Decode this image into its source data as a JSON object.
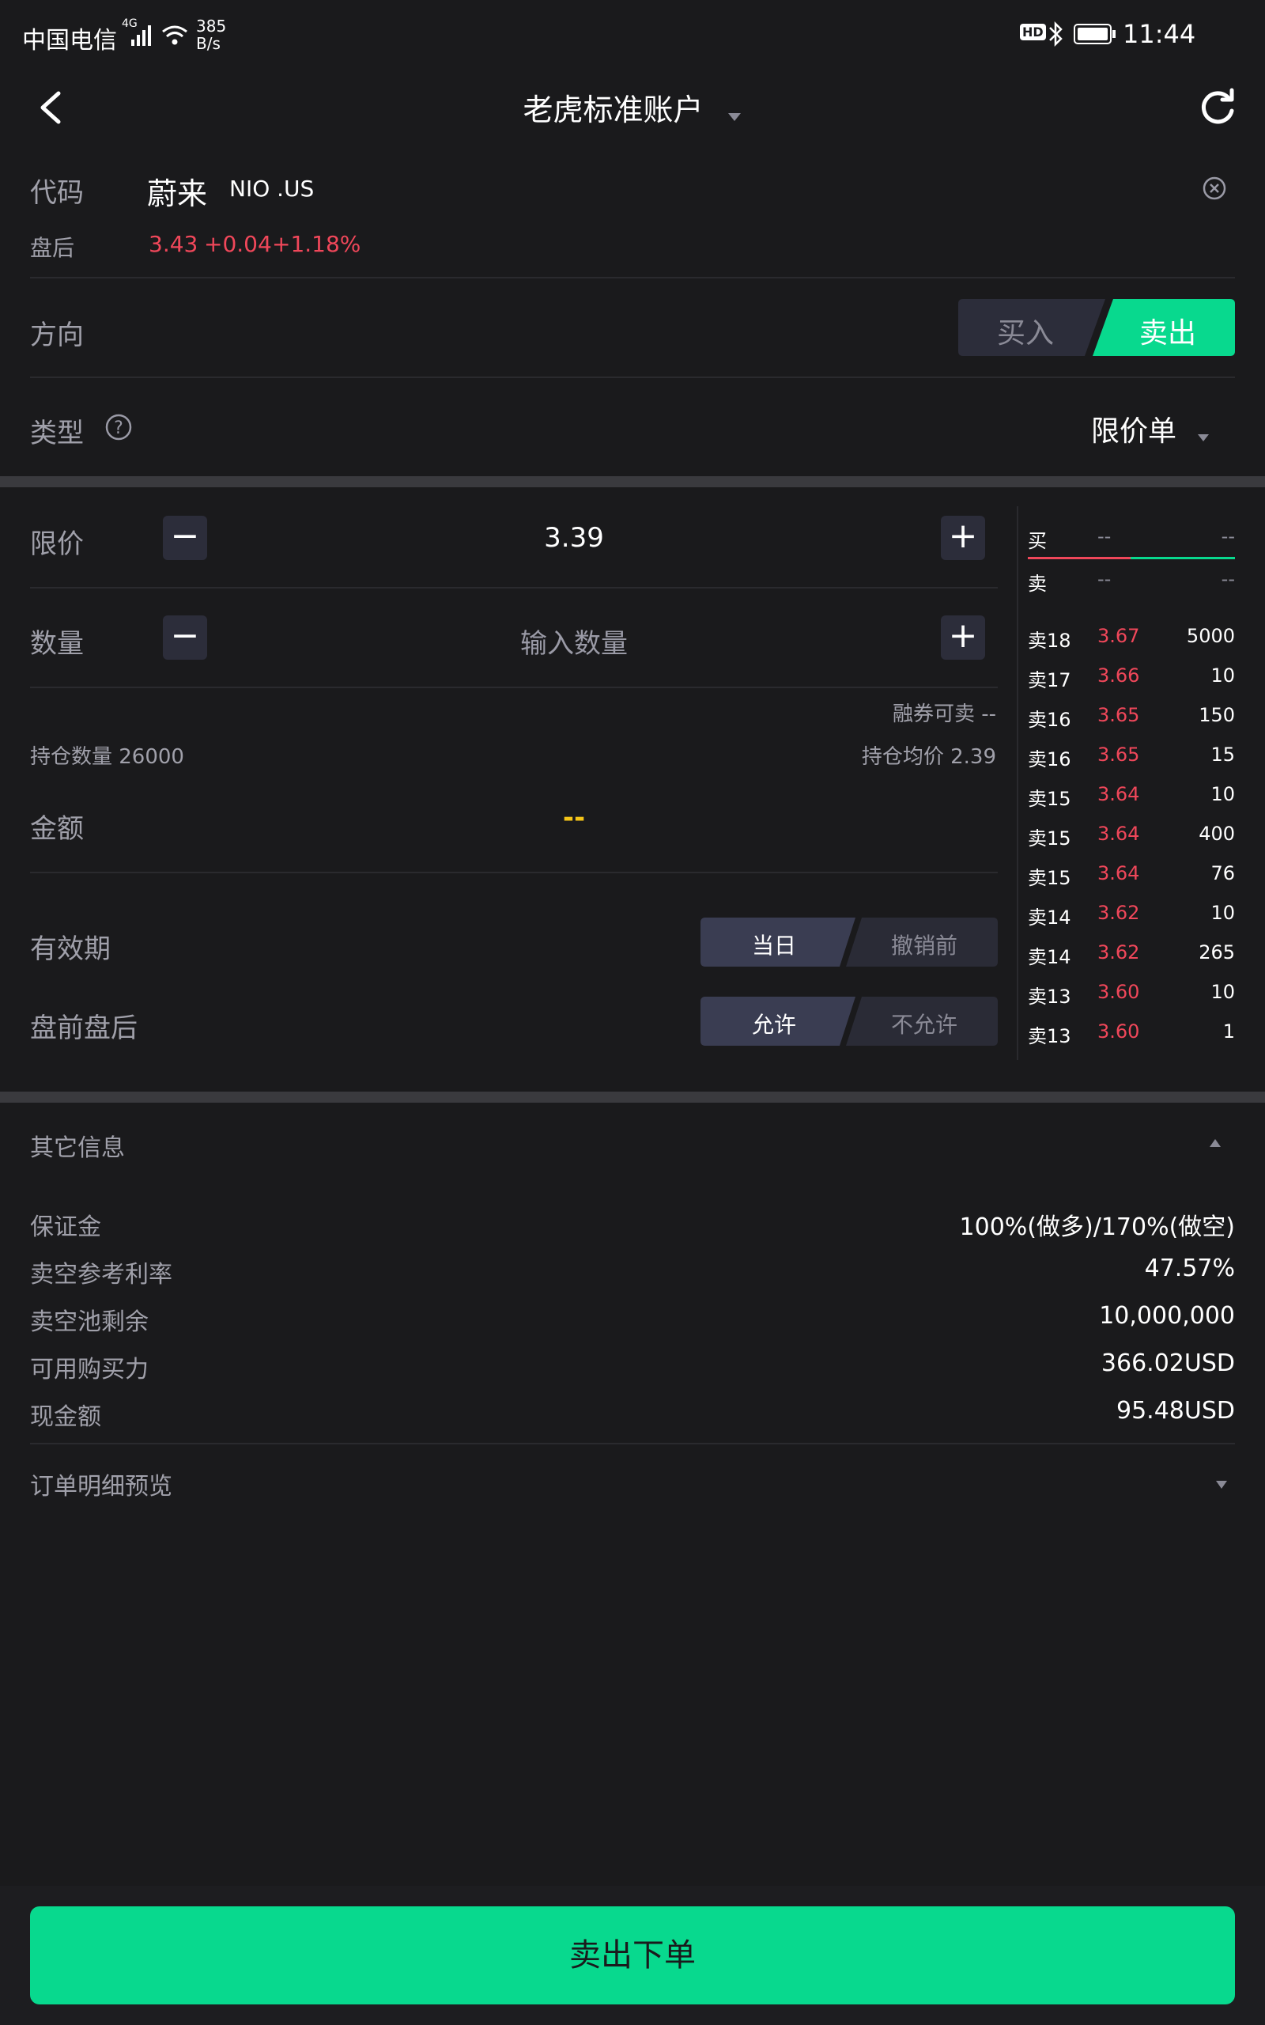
{
  "status_bar": {
    "carrier": "中国电信",
    "network": "4G",
    "speed_value": "385",
    "speed_unit": "B/s",
    "hd": "HD",
    "time": "11:44"
  },
  "header": {
    "title": "老虎标准账户"
  },
  "symbol": {
    "label": "代码",
    "name": "蔚来",
    "ticker": "NIO .US"
  },
  "after_hours": {
    "label": "盘后",
    "price": "3.43",
    "change": "+0.04",
    "change_pct": "+1.18%"
  },
  "direction": {
    "label": "方向",
    "buy": "买入",
    "sell": "卖出",
    "selected": "卖出"
  },
  "order_type": {
    "label": "类型",
    "help_icon_text": "?",
    "value": "限价单"
  },
  "limit_price": {
    "label": "限价",
    "value": "3.39",
    "minus": "−",
    "plus": "+"
  },
  "quantity": {
    "label": "数量",
    "placeholder": "输入数量",
    "minus": "−",
    "plus": "+"
  },
  "margin_sell": "融券可卖 --",
  "position_qty": "持仓数量 26000",
  "position_avg": "持仓均价 2.39",
  "amount": {
    "label": "金额",
    "value": "--"
  },
  "validity": {
    "label": "有效期",
    "options": [
      "当日",
      "撤销前"
    ],
    "selected": "当日"
  },
  "extended_hours": {
    "label": "盘前盘后",
    "options": [
      "允许",
      "不允许"
    ],
    "selected": "允许"
  },
  "order_book": {
    "bid_label": "买",
    "ask_label": "卖",
    "bid_price": "--",
    "bid_qty": "--",
    "ask_price": "--",
    "ask_qty": "--",
    "levels": [
      {
        "label": "卖18",
        "price": "3.67",
        "qty": "5000"
      },
      {
        "label": "卖17",
        "price": "3.66",
        "qty": "10"
      },
      {
        "label": "卖16",
        "price": "3.65",
        "qty": "150"
      },
      {
        "label": "卖16",
        "price": "3.65",
        "qty": "15"
      },
      {
        "label": "卖15",
        "price": "3.64",
        "qty": "10"
      },
      {
        "label": "卖15",
        "price": "3.64",
        "qty": "400"
      },
      {
        "label": "卖15",
        "price": "3.64",
        "qty": "76"
      },
      {
        "label": "卖14",
        "price": "3.62",
        "qty": "10"
      },
      {
        "label": "卖14",
        "price": "3.62",
        "qty": "265"
      },
      {
        "label": "卖13",
        "price": "3.60",
        "qty": "10"
      },
      {
        "label": "卖13",
        "price": "3.60",
        "qty": "1"
      }
    ]
  },
  "other_info": {
    "title": "其它信息",
    "rows": [
      {
        "key": "保证金",
        "value": "100%(做多)/170%(做空)"
      },
      {
        "key": "卖空参考利率",
        "value": "47.57%"
      },
      {
        "key": "卖空池剩余",
        "value": "10,000,000"
      },
      {
        "key": "可用购买力",
        "value": "366.02USD"
      },
      {
        "key": "现金额",
        "value": "95.48USD"
      }
    ]
  },
  "order_preview": {
    "title": "订单明细预览"
  },
  "submit": {
    "label": "卖出下单"
  },
  "colors": {
    "accent_green": "#08d98e",
    "price_red": "#f0475a",
    "amount_yellow": "#f5c518"
  }
}
